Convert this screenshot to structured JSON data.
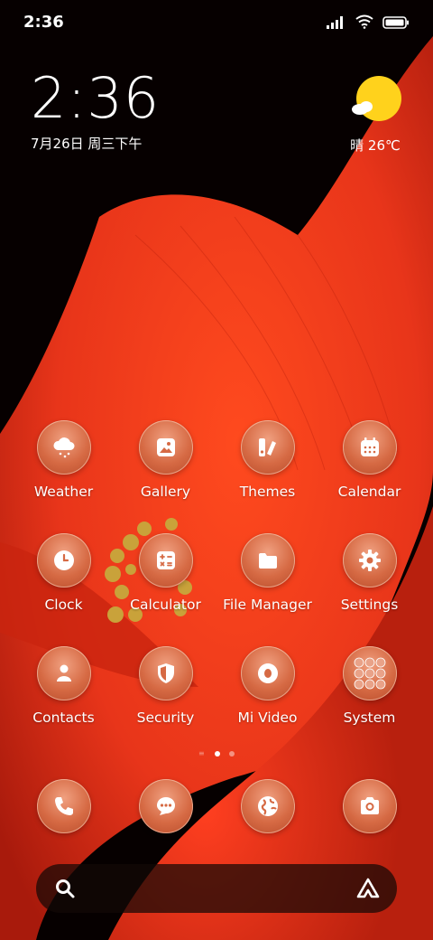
{
  "status_bar": {
    "time": "2:36"
  },
  "clock_widget": {
    "time": "2:36",
    "date": "7月26日 周三下午"
  },
  "weather_widget": {
    "text": "晴 26℃"
  },
  "apps": [
    {
      "label": "Weather",
      "icon": "cloud-snow-icon"
    },
    {
      "label": "Gallery",
      "icon": "image-icon"
    },
    {
      "label": "Themes",
      "icon": "palette-icon"
    },
    {
      "label": "Calendar",
      "icon": "calendar-icon"
    },
    {
      "label": "Clock",
      "icon": "clock-icon"
    },
    {
      "label": "Calculator",
      "icon": "calculator-icon"
    },
    {
      "label": "File Manager",
      "icon": "folder-icon"
    },
    {
      "label": "Settings",
      "icon": "gear-icon"
    },
    {
      "label": "Contacts",
      "icon": "person-icon"
    },
    {
      "label": "Security",
      "icon": "shield-icon"
    },
    {
      "label": "Mi Video",
      "icon": "video-icon"
    },
    {
      "label": "System",
      "icon": "folder-grid-icon"
    }
  ],
  "dock": [
    {
      "icon": "phone-icon"
    },
    {
      "icon": "message-icon"
    },
    {
      "icon": "browser-icon"
    },
    {
      "icon": "camera-icon"
    }
  ],
  "page_indicator": {
    "pages": 2,
    "current": 1
  },
  "colors": {
    "accent": "#d66a44",
    "flower": "#e8391a"
  }
}
